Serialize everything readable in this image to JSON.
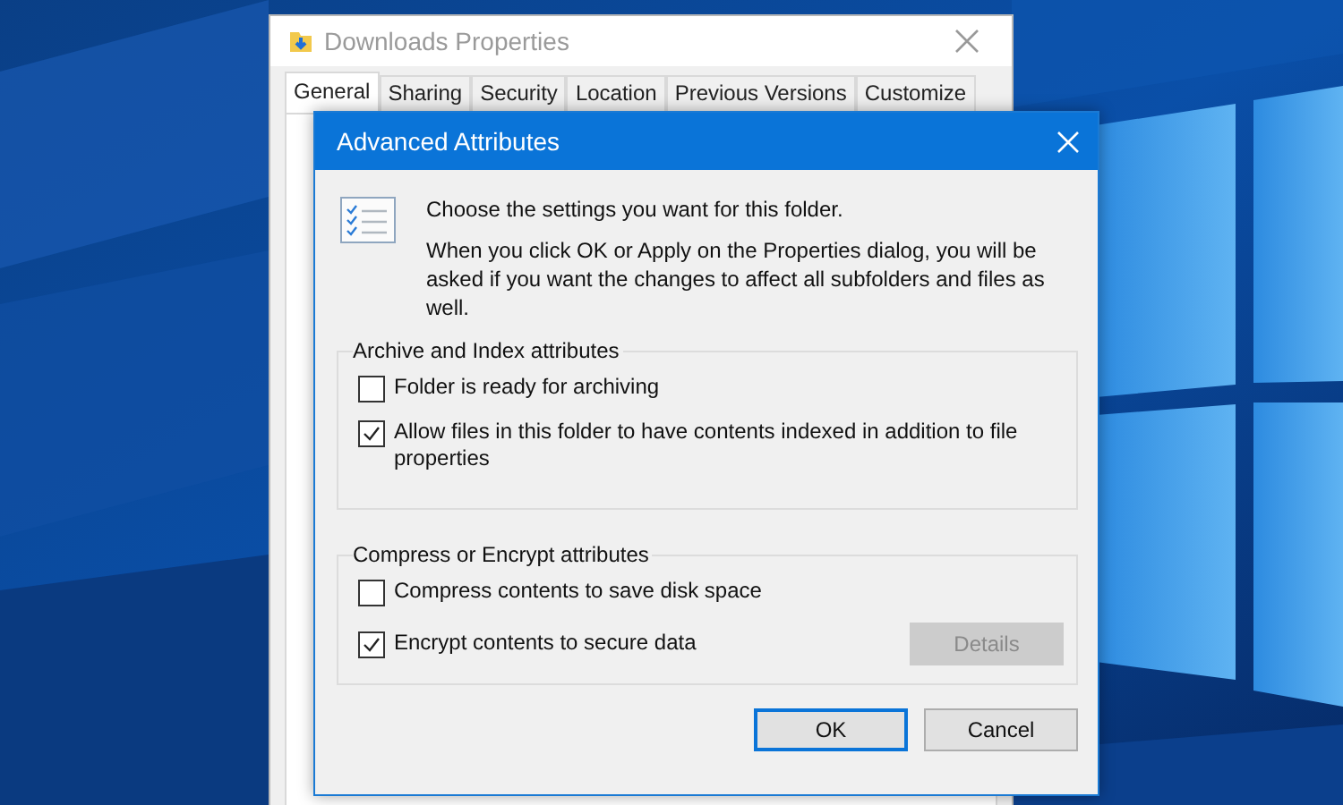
{
  "properties_window": {
    "title": "Downloads Properties",
    "tabs": [
      {
        "label": "General",
        "selected": true
      },
      {
        "label": "Sharing",
        "selected": false
      },
      {
        "label": "Security",
        "selected": false
      },
      {
        "label": "Location",
        "selected": false
      },
      {
        "label": "Previous Versions",
        "selected": false
      },
      {
        "label": "Customize",
        "selected": false
      }
    ]
  },
  "dialog": {
    "title": "Advanced Attributes",
    "heading": "Choose the settings you want for this folder.",
    "description": "When you click OK or Apply on the Properties dialog, you will be asked if you want the changes to affect all subfolders and files as well.",
    "groups": [
      {
        "title": "Archive and Index attributes",
        "options": [
          {
            "label": "Folder is ready for archiving",
            "checked": false
          },
          {
            "label": "Allow files in this folder to have contents indexed in addition to file properties",
            "checked": true
          }
        ]
      },
      {
        "title": "Compress or Encrypt attributes",
        "options": [
          {
            "label": "Compress contents to save disk space",
            "checked": false
          },
          {
            "label": "Encrypt contents to secure data",
            "checked": true
          }
        ],
        "button": {
          "label": "Details",
          "disabled": true
        }
      }
    ],
    "buttons": [
      {
        "label": "OK",
        "default": true
      },
      {
        "label": "Cancel",
        "default": false
      }
    ]
  }
}
